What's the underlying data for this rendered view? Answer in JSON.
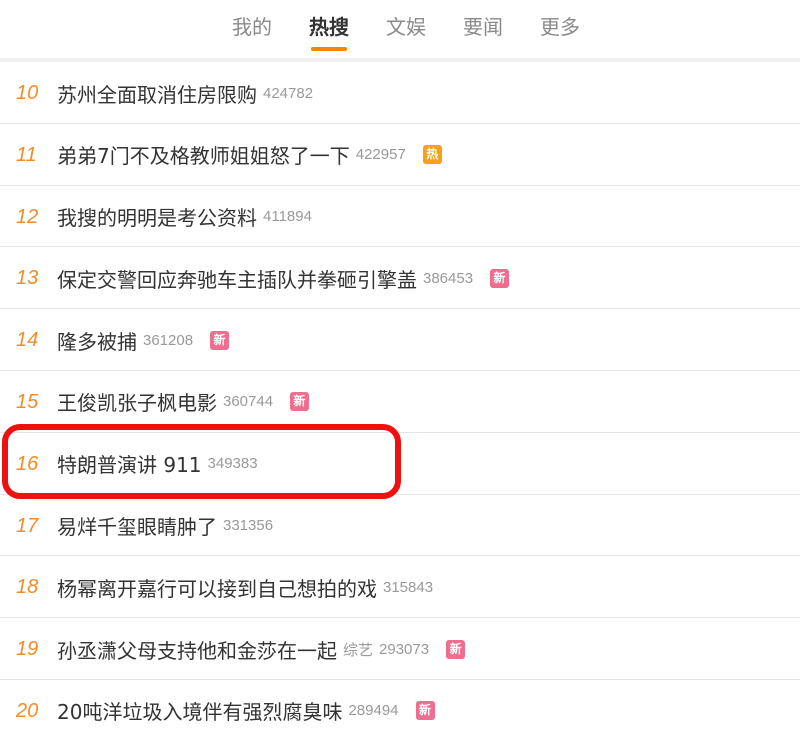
{
  "tabs": [
    {
      "label": "我的",
      "active": false
    },
    {
      "label": "热搜",
      "active": true
    },
    {
      "label": "文娱",
      "active": false
    },
    {
      "label": "要闻",
      "active": false
    },
    {
      "label": "更多",
      "active": false
    }
  ],
  "colors": {
    "accent": "#ff8200",
    "rank": "#f28c28",
    "new_badge": "#ef6d8e",
    "hot_badge": "#f7a01c",
    "highlight": "#ee1111"
  },
  "items": [
    {
      "rank": "10",
      "title": "苏州全面取消住房限购",
      "hot": "424782"
    },
    {
      "rank": "11",
      "title": "弟弟7门不及格教师姐姐怒了一下",
      "hot": "422957",
      "badge": "热"
    },
    {
      "rank": "12",
      "title": "我搜的明明是考公资料",
      "hot": "411894"
    },
    {
      "rank": "13",
      "title": "保定交警回应奔驰车主插队并拳砸引擎盖",
      "hot": "386453",
      "badge": "新"
    },
    {
      "rank": "14",
      "title": "隆多被捕",
      "hot": "361208",
      "badge": "新"
    },
    {
      "rank": "15",
      "title": "王俊凯张子枫电影",
      "hot": "360744",
      "badge": "新"
    },
    {
      "rank": "16",
      "title": "特朗普演讲 911",
      "hot": "349383"
    },
    {
      "rank": "17",
      "title": "易烊千玺眼睛肿了",
      "hot": "331356"
    },
    {
      "rank": "18",
      "title": "杨幂离开嘉行可以接到自己想拍的戏",
      "hot": "315843"
    },
    {
      "rank": "19",
      "title": "孙丞潇父母支持他和金莎在一起",
      "category": "综艺",
      "hot": "293073",
      "badge": "新"
    },
    {
      "rank": "20",
      "title": "20吨洋垃圾入境伴有强烈腐臭味",
      "hot": "289494",
      "badge": "新"
    }
  ]
}
